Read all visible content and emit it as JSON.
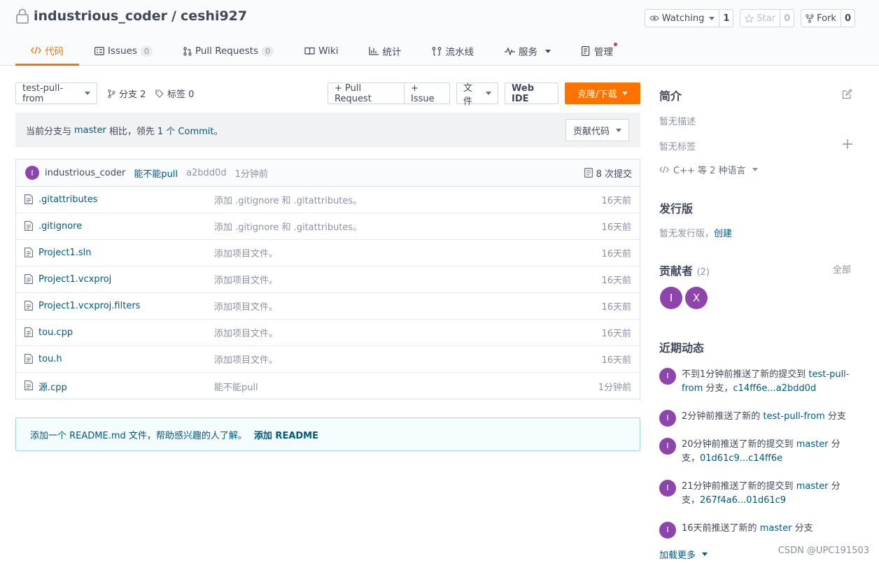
{
  "repo": {
    "owner": "industrious_coder",
    "separator": "/",
    "name": "ceshi927"
  },
  "actions": {
    "watch": {
      "label": "Watching",
      "count": "1"
    },
    "star": {
      "label": "Star",
      "count": "0"
    },
    "fork": {
      "label": "Fork",
      "count": "0"
    }
  },
  "tabs": [
    {
      "label": "代码",
      "icon": "code-icon",
      "active": true
    },
    {
      "label": "Issues",
      "badge": "0",
      "icon": "issues-icon"
    },
    {
      "label": "Pull Requests",
      "badge": "0",
      "icon": "pull-request-icon"
    },
    {
      "label": "Wiki",
      "icon": "wiki-icon"
    },
    {
      "label": "统计",
      "icon": "chart-icon"
    },
    {
      "label": "流水线",
      "icon": "pipeline-icon"
    },
    {
      "label": "服务",
      "icon": "pulse-icon"
    },
    {
      "label": "管理",
      "icon": "manage-icon"
    }
  ],
  "toolbar": {
    "branch": "test-pull-from",
    "branches_label": "分支 2",
    "tags_label": "标签 0",
    "pull_request": "+ Pull Request",
    "issue": "+ Issue",
    "file": "文件",
    "web_ide": "Web IDE",
    "clone": "克隆/下载"
  },
  "compare": {
    "prefix": "当前分支与",
    "branch": "master",
    "mid": "相比，领先",
    "count_link": "1 个 Commit",
    "suffix": "。",
    "contribute": "贡献代码"
  },
  "last_commit": {
    "avatar": "I",
    "author": "industrious_coder",
    "message": "能不能pull",
    "hash": "a2bdd0d",
    "time": "1分钟前",
    "count": "8 次提交"
  },
  "files": [
    {
      "name": ".gitattributes",
      "message": "添加 .gitignore 和 .gitattributes。",
      "time": "16天前"
    },
    {
      "name": ".gitignore",
      "message": "添加 .gitignore 和 .gitattributes。",
      "time": "16天前"
    },
    {
      "name": "Project1.sln",
      "message": "添加项目文件。",
      "time": "16天前"
    },
    {
      "name": "Project1.vcxproj",
      "message": "添加项目文件。",
      "time": "16天前"
    },
    {
      "name": "Project1.vcxproj.filters",
      "message": "添加项目文件。",
      "time": "16天前"
    },
    {
      "name": "tou.cpp",
      "message": "添加项目文件。",
      "time": "16天前"
    },
    {
      "name": "tou.h",
      "message": "添加项目文件。",
      "time": "16天前"
    },
    {
      "name": "源.cpp",
      "message": "能不能pull",
      "time": "1分钟前"
    }
  ],
  "readme": {
    "text": "添加一个 README.md 文件，帮助感兴趣的人了解。",
    "link": "添加 README"
  },
  "sidebar": {
    "intro_title": "简介",
    "no_desc": "暂无描述",
    "no_tags": "暂无标签",
    "languages": "C++ 等 2 种语言",
    "release_title": "发行版",
    "no_release": "暂无发行版，",
    "create": "创建",
    "contributors_title": "贡献者",
    "contributors_count": "(2)",
    "all": "全部",
    "contributors": [
      "I",
      "X"
    ],
    "activity_title": "近期动态",
    "activity": [
      {
        "avatar": "I",
        "pre": "不到1分钟前推送了新的提交到",
        "link": "test-pull-from",
        "mid": "分支，",
        "link2": "c14ff6e...a2bdd0d"
      },
      {
        "avatar": "I",
        "pre": "2分钟前推送了新的",
        "link": "test-pull-from",
        "mid": "分支",
        "link2": ""
      },
      {
        "avatar": "I",
        "pre": "20分钟前推送了新的提交到",
        "link": "master",
        "mid": "分支，",
        "link2": "01d61c9...c14ff6e"
      },
      {
        "avatar": "I",
        "pre": "21分钟前推送了新的提交到",
        "link": "master",
        "mid": "分支，",
        "link2": "267f4a6...01d61c9"
      },
      {
        "avatar": "I",
        "pre": "16天前推送了新的",
        "link": "master",
        "mid": "分支",
        "link2": ""
      }
    ],
    "load_more": "加载更多"
  },
  "watermark": "CSDN @UPC191503",
  "colors": {
    "accent": "#fe7300",
    "link": "#005980",
    "avatar": "#8e44ad"
  }
}
